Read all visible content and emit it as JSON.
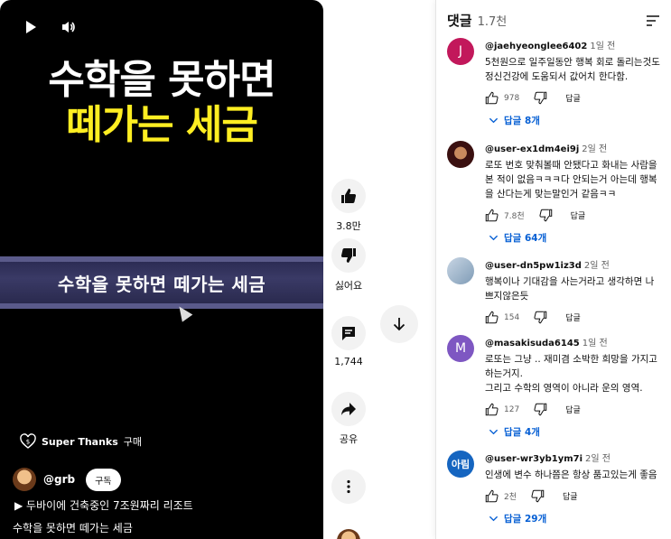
{
  "video": {
    "overlay_line1": "수학을 못하면",
    "overlay_line2": "떼가는 세금",
    "band_caption": "수학을 못하면 떼가는 세금",
    "super_thanks_label": "Super Thanks",
    "super_thanks_suffix": "구매",
    "channel_name": "@grb",
    "subscribe_label": "구독",
    "playlist_label": "▶ 두바이에 건축중인 7조원짜리 리조트",
    "title": "수학을 못하면 떼가는 세금",
    "icons": [
      "play-icon",
      "volume-icon",
      "super-thanks-icon"
    ]
  },
  "actions": {
    "like_count": "3.8만",
    "dislike_label": "싫어요",
    "comment_count": "1,744",
    "share_label": "공유"
  },
  "comments_panel": {
    "title": "댓글",
    "count": "1.7천",
    "items": [
      {
        "avatar_letter": "J",
        "avatar_color": "#c2185b",
        "author": "@jaehyeonglee6402",
        "time": "1일 전",
        "text": "5천원으로 일주일동안 행복 회로 돌리는것도 정신건강에 도움되서 값어치 한다함.",
        "likes": "978",
        "reply_label": "답글",
        "replies_label": "답글 8개"
      },
      {
        "avatar_letter": "",
        "avatar_color": "#7a1f1f",
        "author": "@user-ex1dm4ei9j",
        "time": "2일 전",
        "text": "로또 번호 맞춰볼때 안됐다고 화내는 사람을 본 적이 없음ㅋㅋㅋ다 안되는거 아는데 행복을 산다는게 맞는말인거 같음ㅋㅋ",
        "likes": "7.8천",
        "reply_label": "답글",
        "replies_label": "답글 64개"
      },
      {
        "avatar_letter": "",
        "avatar_color": "#9fb6cc",
        "author": "@user-dn5pw1iz3d",
        "time": "2일 전",
        "text": "행복이나 기대감을 사는거라고 생각하면 나쁘지않은듯",
        "likes": "154",
        "reply_label": "답글",
        "replies_label": ""
      },
      {
        "avatar_letter": "M",
        "avatar_color": "#7e57c2",
        "author": "@masakisuda6145",
        "time": "1일 전",
        "text": "로또는 그냥 .. 재미겸 소박한 희망을 가지고 하는거지.\n그리고 수학의 영역이 아니라 운의 영역.",
        "likes": "127",
        "reply_label": "답글",
        "replies_label": "답글 4개"
      },
      {
        "avatar_letter": "아림",
        "avatar_color": "#1565c0",
        "author": "@user-wr3yb1ym7i",
        "time": "2일 전",
        "text": "인생에 변수 하나쯤은 항상 품고있는게 좋음",
        "likes": "2천",
        "reply_label": "답글",
        "replies_label": "답글 29개"
      }
    ]
  }
}
